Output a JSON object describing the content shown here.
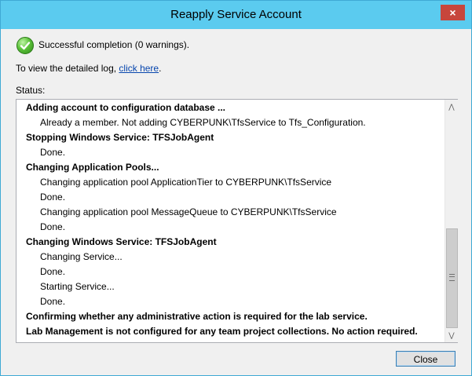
{
  "window": {
    "title": "Reapply Service Account",
    "close_glyph": "×"
  },
  "summary": {
    "icon": "success-check-icon",
    "text": "Successful completion (0 warnings)."
  },
  "log": {
    "prefix": "To view the detailed log, ",
    "link_text": "click here",
    "suffix": "."
  },
  "status": {
    "label": "Status:",
    "lines": [
      {
        "kind": "heading",
        "text": "Adding account to configuration database ..."
      },
      {
        "kind": "detail",
        "text": "Already a member. Not adding CYBERPUNK\\TfsService to Tfs_Configuration."
      },
      {
        "kind": "heading",
        "text": "Stopping Windows Service: TFSJobAgent"
      },
      {
        "kind": "detail",
        "text": "Done."
      },
      {
        "kind": "heading",
        "text": "Changing Application Pools..."
      },
      {
        "kind": "detail",
        "text": "Changing application pool ApplicationTier to CYBERPUNK\\TfsService"
      },
      {
        "kind": "detail",
        "text": "Done."
      },
      {
        "kind": "detail",
        "text": "Changing application pool MessageQueue to CYBERPUNK\\TfsService"
      },
      {
        "kind": "detail",
        "text": "Done."
      },
      {
        "kind": "heading",
        "text": "Changing Windows Service: TFSJobAgent"
      },
      {
        "kind": "detail",
        "text": "Changing Service..."
      },
      {
        "kind": "detail",
        "text": "Done."
      },
      {
        "kind": "detail",
        "text": "Starting Service..."
      },
      {
        "kind": "detail",
        "text": "Done."
      },
      {
        "kind": "heading",
        "text": "Confirming whether any administrative action is required for the lab service."
      },
      {
        "kind": "heading",
        "text": "Lab Management is not configured for any team project collections. No action required."
      }
    ]
  },
  "scrollbar": {
    "up_glyph": "⋀",
    "down_glyph": "⋁"
  },
  "buttons": {
    "close_label": "Close"
  },
  "colors": {
    "titlebar": "#5bcbef",
    "title_close": "#c7463c",
    "link": "#0645ad",
    "success": "#5cc23a"
  }
}
